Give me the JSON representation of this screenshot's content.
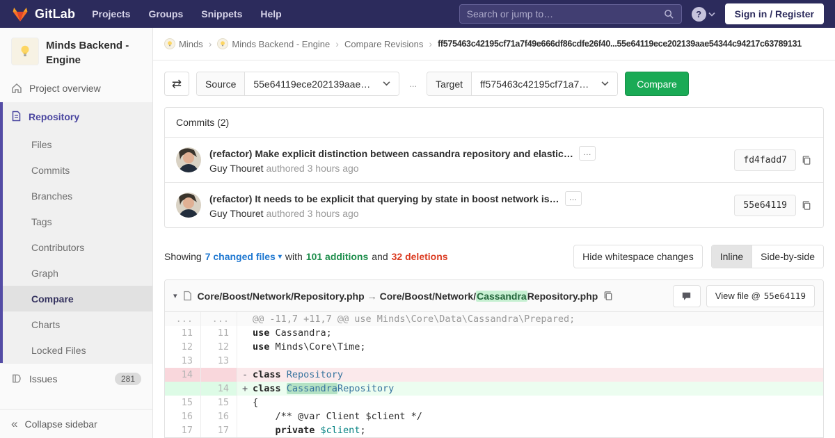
{
  "icons": {
    "swap": "⇄",
    "collapse": "«",
    "more": "…",
    "caret_down": "▾",
    "breadcrumb_sep": "›",
    "search_caret": "⌄"
  },
  "navbar": {
    "logo": "GitLab",
    "links": [
      "Projects",
      "Groups",
      "Snippets",
      "Help"
    ],
    "search_placeholder": "Search or jump to…",
    "help_glyph": "?",
    "signin_label": "Sign in / Register"
  },
  "sidebar": {
    "project_name": "Minds Backend - Engine",
    "overview_label": "Project overview",
    "repo": {
      "label": "Repository",
      "items": [
        "Files",
        "Commits",
        "Branches",
        "Tags",
        "Contributors",
        "Graph",
        "Compare",
        "Charts",
        "Locked Files"
      ],
      "active": "Compare"
    },
    "issues_label": "Issues",
    "issues_count": "281",
    "collapse_label": "Collapse sidebar"
  },
  "breadcrumb": {
    "items": [
      {
        "label": "Minds",
        "avatar": true
      },
      {
        "label": "Minds Backend - Engine",
        "avatar": true
      },
      {
        "label": "Compare Revisions"
      },
      {
        "label": "ff575463c42195cf71a7f49e666df86cdfe26f40...55e64119ece202139aae54344c94217c63789131",
        "current": true
      }
    ]
  },
  "compare_form": {
    "source_label": "Source",
    "source_value": "55e64119ece202139aae…",
    "separator": "...",
    "target_label": "Target",
    "target_value": "ff575463c42195cf71a7…",
    "compare_button": "Compare"
  },
  "commits": {
    "title": "Commits (2)",
    "items": [
      {
        "title": "(refactor) Make explicit distinction between cassandra repository and elastic…",
        "author": "Guy Thouret",
        "meta": "authored 3 hours ago",
        "sha": "fd4fadd7"
      },
      {
        "title": "(refactor) It needs to be explicit that querying by state in boost network is…",
        "author": "Guy Thouret",
        "meta": "authored 3 hours ago",
        "sha": "55e64119"
      }
    ]
  },
  "summary": {
    "prefix": "Showing",
    "files": "7 changed files",
    "with_word": "with",
    "additions": "101 additions",
    "and_word": "and",
    "deletions": "32 deletions",
    "whitespace_button": "Hide whitespace changes",
    "inline_button": "Inline",
    "side_by_side_button": "Side-by-side"
  },
  "diff": {
    "old_path": "Core/Boost/Network/Repository.php",
    "arrow": "→",
    "new_path_prefix": "Core/Boost/Network/",
    "new_path_highlight": "Cassandra",
    "new_path_suffix": "Repository.php",
    "view_file_label": "View file @",
    "view_file_sha": "55e64119",
    "lines": [
      {
        "type": "hunk",
        "old": "...",
        "new": "...",
        "segments": [
          {
            "t": "@@ -11,7 +11,7 @@ use Minds\\Core\\Data\\Cassandra\\Prepared;"
          }
        ]
      },
      {
        "type": "ctx",
        "old": "11",
        "new": "11",
        "segments": [
          {
            "t": "use ",
            "c": "k"
          },
          {
            "t": "Cassandra;"
          }
        ]
      },
      {
        "type": "ctx",
        "old": "12",
        "new": "12",
        "segments": [
          {
            "t": "use ",
            "c": "k"
          },
          {
            "t": "Minds\\Core\\Time;"
          }
        ]
      },
      {
        "type": "ctx",
        "old": "13",
        "new": "13",
        "segments": []
      },
      {
        "type": "del",
        "old": "14",
        "new": "",
        "sign": "-",
        "segments": [
          {
            "t": "class ",
            "c": "k"
          },
          {
            "t": "Repository",
            "c": "cls"
          }
        ]
      },
      {
        "type": "add",
        "old": "",
        "new": "14",
        "sign": "+",
        "segments": [
          {
            "t": "class ",
            "c": "k"
          },
          {
            "t": "Cassandra",
            "c": "cls hl"
          },
          {
            "t": "Repository",
            "c": "cls"
          }
        ]
      },
      {
        "type": "ctx",
        "old": "15",
        "new": "15",
        "segments": [
          {
            "t": "{"
          }
        ]
      },
      {
        "type": "ctx",
        "old": "16",
        "new": "16",
        "segments": [
          {
            "t": "    /** @var Client $client */"
          }
        ]
      },
      {
        "type": "ctx",
        "old": "17",
        "new": "17",
        "segments": [
          {
            "t": "    "
          },
          {
            "t": "private ",
            "c": "k"
          },
          {
            "t": "$client",
            "c": "var"
          },
          {
            "t": ";"
          }
        ]
      }
    ]
  }
}
